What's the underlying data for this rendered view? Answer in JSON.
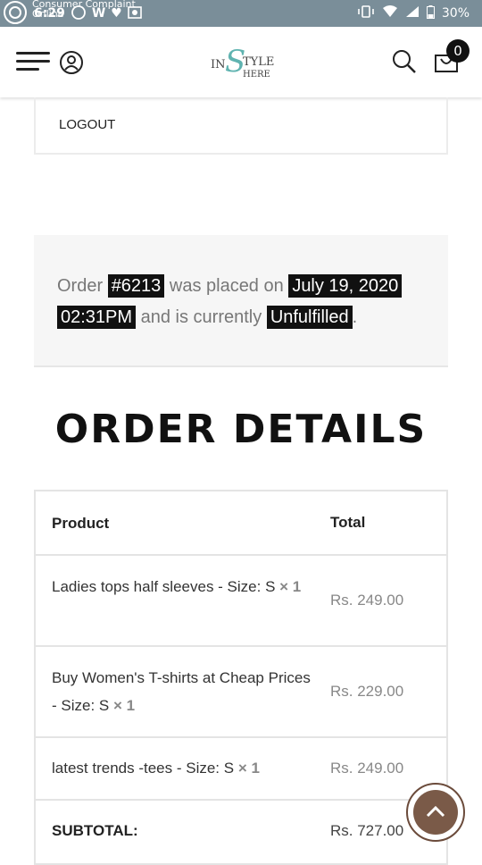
{
  "status_bar": {
    "time": "6:29",
    "overlay_text_line1": "Consumer Complaint",
    "overlay_text_line2": "Online",
    "battery": "30%"
  },
  "header": {
    "logo_text": "IN STYLE HERE",
    "cart_count": "0"
  },
  "account_menu": {
    "logout_label": "LOGOUT"
  },
  "order_notice": {
    "prefix": "Order",
    "order_number": "#6213",
    "placed_text": "was placed on",
    "date": "July 19, 2020",
    "time": "02:31PM",
    "status_text": "and is currently",
    "status": "Unfulfilled",
    "suffix": "."
  },
  "order_details": {
    "title": "ORDER DETAILS",
    "headers": {
      "product": "Product",
      "total": "Total"
    },
    "items": [
      {
        "name": "Ladies tops half sleeves - Size: S",
        "qty": "× 1",
        "total": "Rs. 249.00"
      },
      {
        "name": "Buy Women's T-shirts at Cheap Prices - Size: S",
        "qty": "× 1",
        "total": "Rs. 229.00"
      },
      {
        "name": "latest trends -tees - Size: S",
        "qty": "× 1",
        "total": "Rs. 249.00"
      }
    ],
    "subtotal_label": "SUBTOTAL:",
    "subtotal_value": "Rs. 727.00"
  },
  "colors": {
    "status_bar": "#7a8e99",
    "back_to_top": "#7a5a48",
    "logo_accent": "#5fb3b0"
  }
}
